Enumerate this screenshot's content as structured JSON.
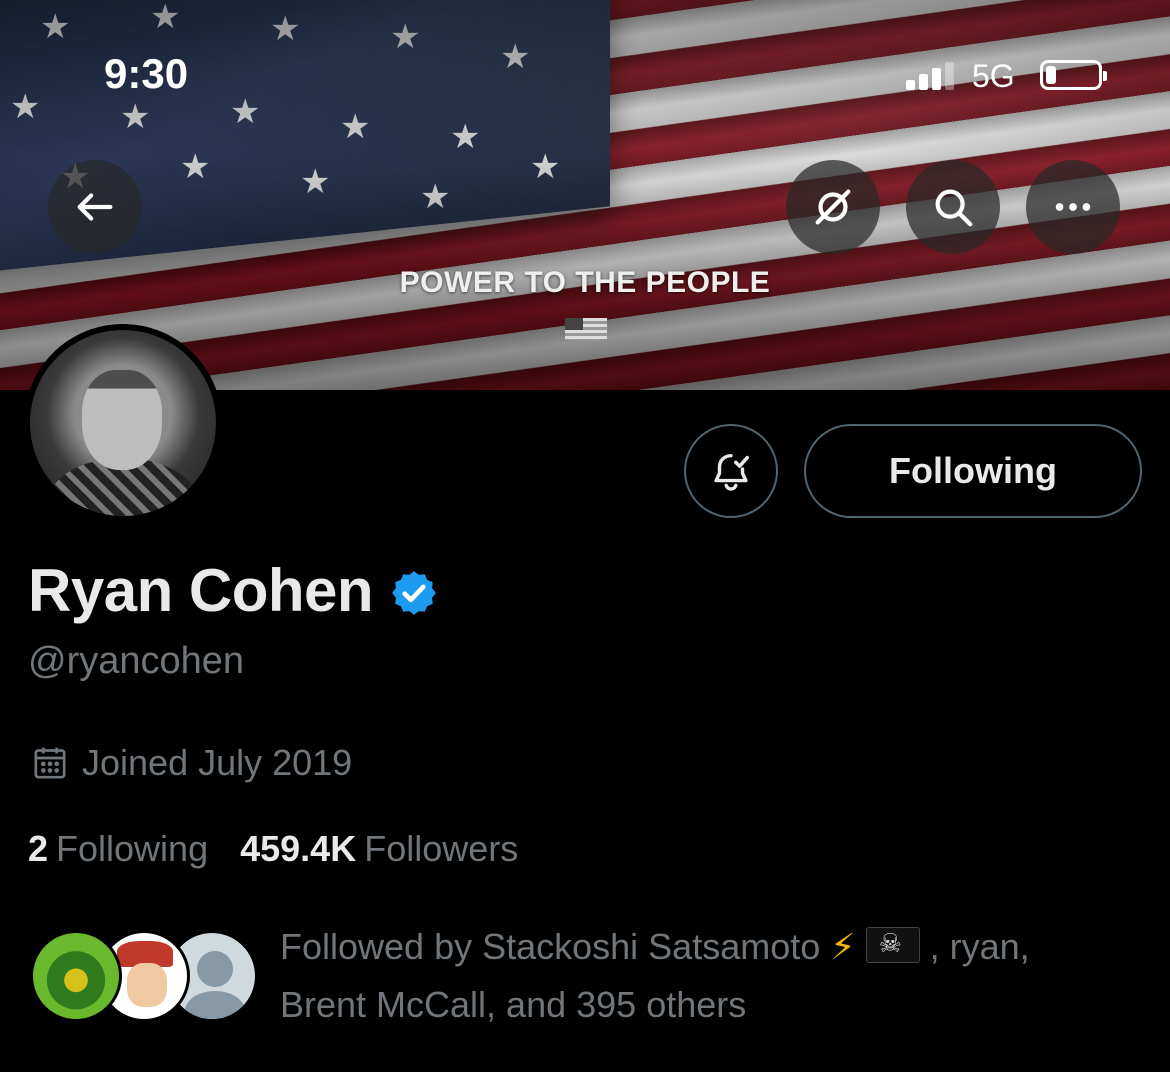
{
  "status_bar": {
    "time": "9:30",
    "network": "5G"
  },
  "header": {
    "back_icon": "arrow-left-icon",
    "actions": [
      "grok-icon",
      "search-icon",
      "more-icon"
    ]
  },
  "banner": {
    "text": "POWER TO THE PEOPLE",
    "emoji": "us-flag-icon"
  },
  "profile": {
    "following_button_label": "Following",
    "notify_icon": "bell-check-icon",
    "display_name": "Ryan Cohen",
    "verified_color": "#1d9bf0",
    "handle": "@ryancohen",
    "joined": "Joined July 2019",
    "following_count": "2",
    "following_label": "Following",
    "followers_count": "459.4K",
    "followers_label": "Followers"
  },
  "followed_by": {
    "prefix": "Followed by Stackoshi Satsamoto",
    "bolt": "⚡",
    "suffix_line1": " , ryan,",
    "line2": "Brent McCall, and 395 others"
  },
  "colors": {
    "background": "#000000",
    "primary_text": "#e7e9ea",
    "secondary_text": "#71767b",
    "border": "#536471"
  }
}
